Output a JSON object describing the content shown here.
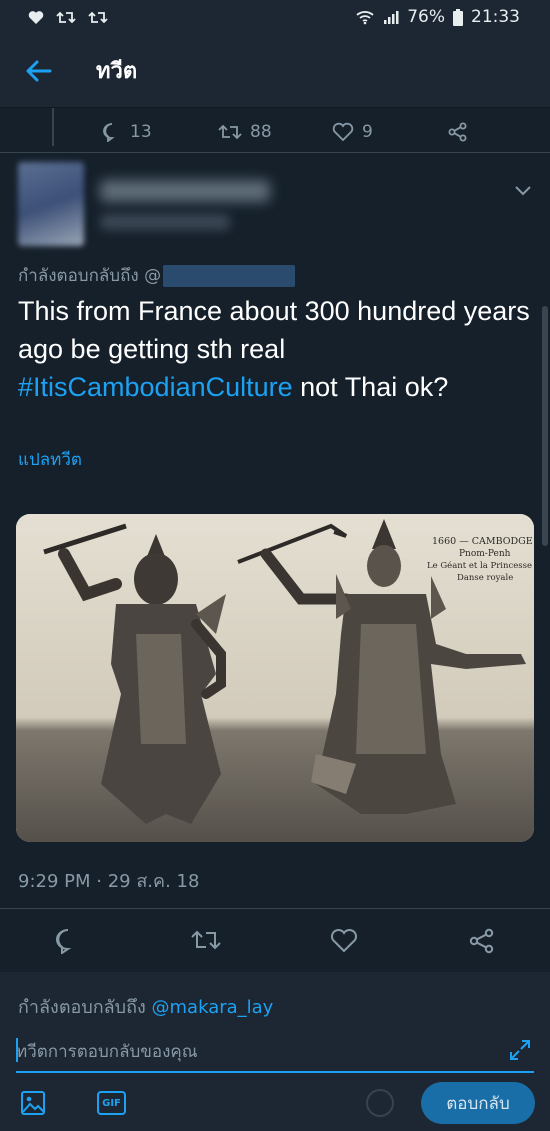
{
  "status_bar": {
    "battery": "76%",
    "time": "21:33",
    "icons": [
      "heart-icon",
      "retweet-icon",
      "retweet-icon",
      "wifi-icon",
      "signal-icon",
      "battery-icon"
    ]
  },
  "app_bar": {
    "title": "ทวีต",
    "back_icon": "arrow-left-icon"
  },
  "previous_tweet": {
    "replies": "13",
    "retweets": "88",
    "likes": "9"
  },
  "tweet": {
    "replying_to_label": "กำลังตอบกลับถึง @",
    "text_part1": "This from France about 300 hundred years ago be getting sth real ",
    "hashtag": "#ItisCambodianCulture",
    "text_part2": " not Thai ok?",
    "translate_label": "แปลทวีต",
    "photo_caption": {
      "line1": "1660 — CAMBODGE",
      "line2": "Pnom-Penh",
      "line3": "Le Géant et la Princesse",
      "line4": "Danse royale"
    },
    "timestamp": "9:29 PM · 29 ส.ค. 18"
  },
  "composer": {
    "replying_to_label": "กำลังตอบกลับถึง ",
    "replying_to_handle": "@makara_lay",
    "placeholder": "ทวีตการตอบกลับของคุณ",
    "gif_label": "GIF",
    "reply_button": "ตอบกลับ"
  },
  "colors": {
    "background": "#15202b",
    "accent": "#1da1f2",
    "muted": "#8899a6"
  }
}
